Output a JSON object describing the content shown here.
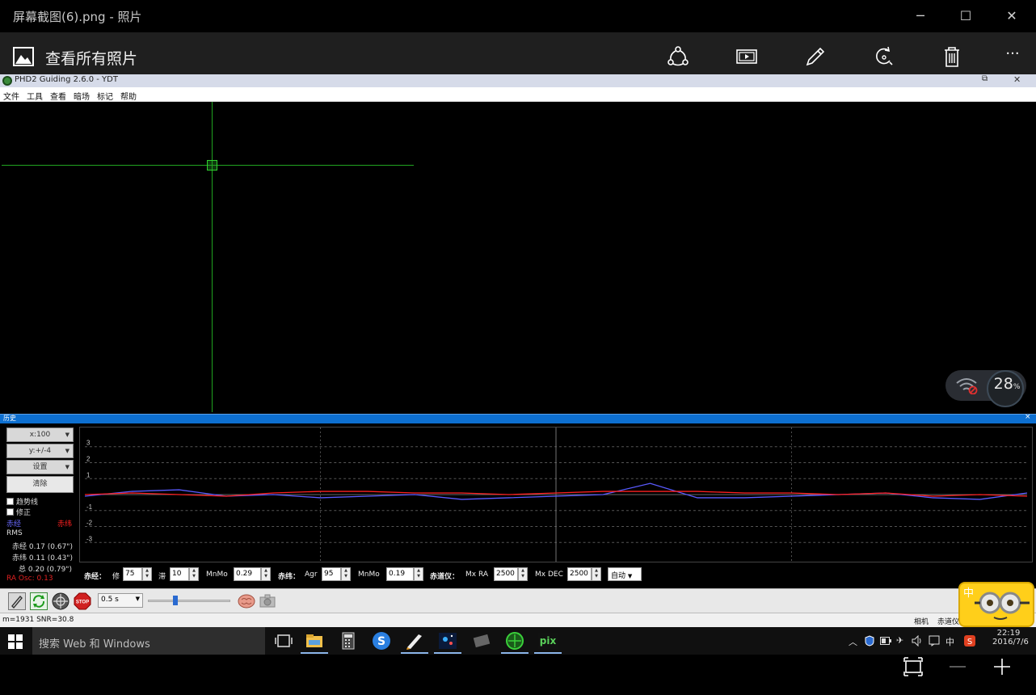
{
  "viewer": {
    "window_title": "屏幕截图(6).png - 照片",
    "all_photos_label": "查看所有照片",
    "window_buttons": {
      "minimize": "─",
      "maximize": "☐",
      "close": "✕"
    },
    "toolbar_icons": [
      "share-icon",
      "slideshow-icon",
      "edit-icon",
      "rotate-icon",
      "delete-icon",
      "more-icon"
    ],
    "more_label": "···"
  },
  "phd2": {
    "window_title": "PHD2 Guiding 2.6.0 - YDT",
    "menu": [
      "文件",
      "工具",
      "查看",
      "暗场",
      "标记",
      "帮助"
    ],
    "net_widget": {
      "percent": "28",
      "unit": "%"
    },
    "history": {
      "title": "历史",
      "close": "×",
      "x_scale": "x:100",
      "y_scale": "y:+/-4",
      "settings": "设置",
      "clear": "清除",
      "trendline": "趋势线",
      "correction": "修正",
      "legend_ra": "赤经",
      "legend_dec": "赤纬",
      "rms_label": "RMS",
      "rms_ra": "赤经 0.17 (0.67\")",
      "rms_dec": "赤纬 0.11 (0.43\")",
      "rms_total": "总 0.20 (0.79\")",
      "ra_osc": "RA Osc: 0.13",
      "y_ticks": [
        "3",
        "2",
        "1",
        "-1",
        "-2",
        "-3"
      ]
    },
    "params": {
      "ra_label": "赤经：",
      "ra_hyst_label": "修",
      "ra_hyst": "75",
      "ra_agg_label": "滞",
      "ra_agg": "10",
      "ra_minmo_label": "MnMo",
      "ra_minmo": "0.29",
      "dec_label": "赤纬：",
      "dec_agg_label": "Agr",
      "dec_agg": "95",
      "dec_minmo_label": "MnMo",
      "dec_minmo": "0.19",
      "mount_label": "赤道仪：",
      "mx_ra_label": "Mx RA",
      "mx_ra": "2500",
      "mx_dec_label": "Mx DEC",
      "mx_dec": "2500",
      "dec_mode": "自动"
    },
    "toolbar": {
      "exposure": "0.5 s",
      "buttons": [
        "connect-icon",
        "loop-icon",
        "guide-icon",
        "stop-icon",
        "brain-icon",
        "camera-icon"
      ],
      "stop_label": "STOP"
    },
    "status": {
      "left": "m=1931 SNR=30.8",
      "camera": "相机",
      "mount": "赤道仪"
    },
    "colors": {
      "ra": "#5a5aff",
      "dec": "#ff2020",
      "crosshair": "#21a321"
    }
  },
  "taskbar": {
    "search_placeholder": "搜索 Web 和 Windows",
    "time": "22:19",
    "date": "2016/7/6",
    "ime": "中"
  },
  "bottom_bar_icons": [
    "fit-icon",
    "zoom-out-icon",
    "zoom-in-icon"
  ],
  "chart_data": {
    "type": "line",
    "title": "",
    "xlabel": "",
    "ylabel": "",
    "ylim": [
      -4,
      4
    ],
    "x": [
      0,
      5,
      10,
      15,
      20,
      25,
      30,
      35,
      40,
      45,
      50,
      55,
      60,
      65,
      70,
      75,
      80,
      85,
      90,
      95,
      100
    ],
    "series": [
      {
        "name": "赤经",
        "values": [
          -0.1,
          0.2,
          0.3,
          -0.1,
          0.0,
          -0.2,
          -0.1,
          0.0,
          -0.3,
          -0.2,
          -0.1,
          0.0,
          0.7,
          -0.2,
          -0.2,
          -0.1,
          0.0,
          0.1,
          -0.2,
          -0.3,
          0.1
        ]
      },
      {
        "name": "赤纬",
        "values": [
          0.0,
          0.1,
          0.0,
          -0.1,
          0.1,
          0.2,
          0.2,
          0.1,
          0.1,
          0.0,
          0.1,
          0.2,
          0.2,
          0.2,
          0.1,
          0.1,
          0.0,
          0.1,
          -0.1,
          0.0,
          -0.1
        ]
      }
    ]
  }
}
